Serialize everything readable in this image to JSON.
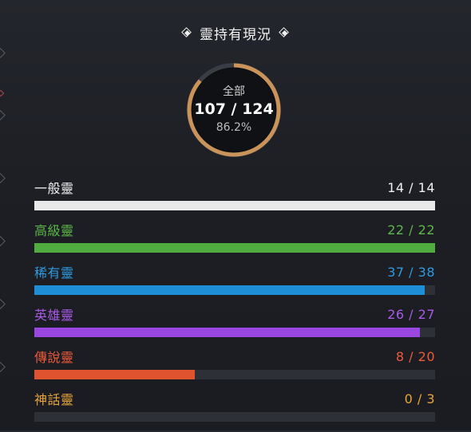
{
  "header": {
    "title": "靈持有現況"
  },
  "summary": {
    "label": "全部",
    "count": "107 / 124",
    "percent": "86.2%",
    "owned": 107,
    "total": 124,
    "ring_color": "#c9935a"
  },
  "rarities": [
    {
      "name": "一般靈",
      "count": "14 / 14",
      "owned": 14,
      "total": 14,
      "color": "#f0f0f0",
      "bar_color": "#e9e9e9"
    },
    {
      "name": "高級靈",
      "count": "22 / 22",
      "owned": 22,
      "total": 22,
      "color": "#5cb948",
      "bar_color": "#4fac3e"
    },
    {
      "name": "稀有靈",
      "count": "37 / 38",
      "owned": 37,
      "total": 38,
      "color": "#2f9be0",
      "bar_color": "#1e8fd6"
    },
    {
      "name": "英雄靈",
      "count": "26 / 27",
      "owned": 26,
      "total": 27,
      "color": "#a95be8",
      "bar_color": "#9a46e0"
    },
    {
      "name": "傳說靈",
      "count": "8 / 20",
      "owned": 8,
      "total": 20,
      "color": "#ee5a3a",
      "bar_color": "#e0532f"
    },
    {
      "name": "神話靈",
      "count": "0 / 3",
      "owned": 0,
      "total": 3,
      "color": "#e8a53a",
      "bar_color": "#e8a53a"
    }
  ]
}
